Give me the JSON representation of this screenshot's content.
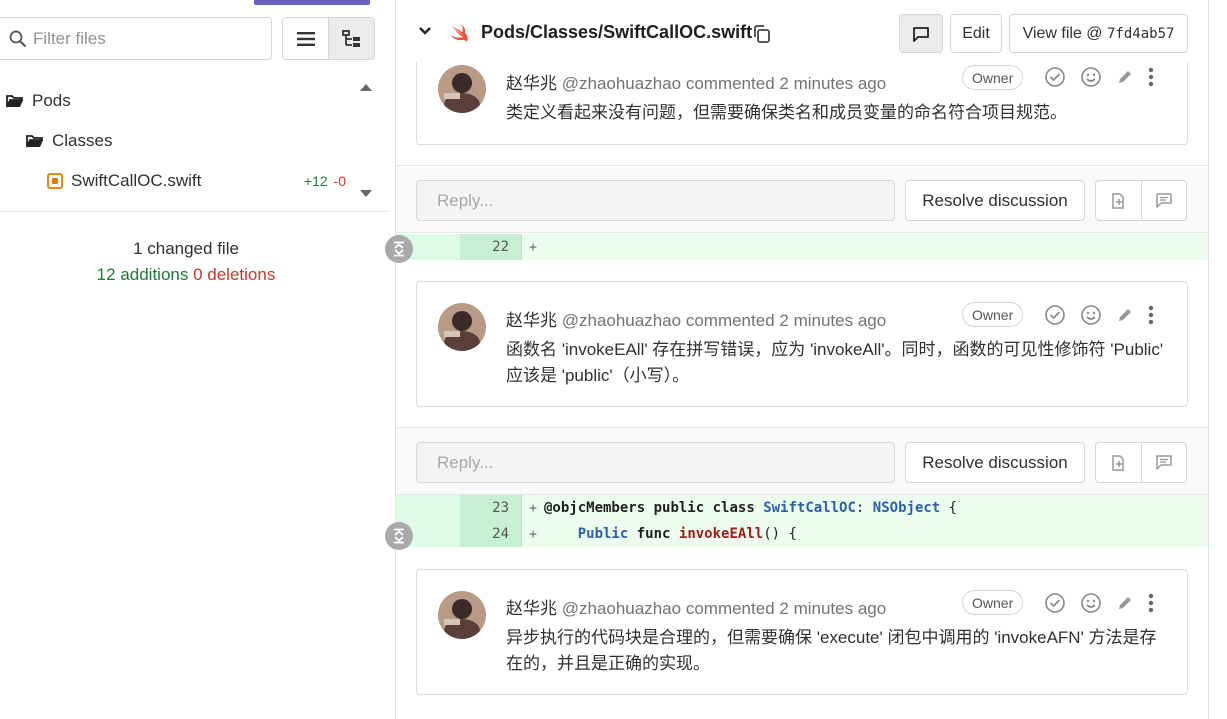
{
  "sidebar": {
    "filter_placeholder": "Filter files",
    "tree": [
      {
        "label": "Pods"
      },
      {
        "label": "Classes"
      },
      {
        "label": "SwiftCallOC.swift",
        "additions": "+12",
        "deletions": "-0"
      }
    ],
    "summary": {
      "changed": "1 changed file",
      "additions": "12 additions",
      "deletions": "0 deletions"
    }
  },
  "file": {
    "path": "Pods/Classes/SwiftCallOC.swift",
    "edit_label": "Edit",
    "view_label": "View file @",
    "commit": "7fd4ab57"
  },
  "discussions": [
    {
      "author": "赵华兆",
      "handle": "@zhaohuazhao",
      "commented": "commented",
      "time": "2 minutes ago",
      "badge": "Owner",
      "body": "类定义看起来没有问题，但需要确保类名和成员变量的命名符合项目规范。"
    },
    {
      "author": "赵华兆",
      "handle": "@zhaohuazhao",
      "commented": "commented",
      "time": "2 minutes ago",
      "badge": "Owner",
      "body": "函数名 'invokeEAll' 存在拼写错误，应为 'invokeAll'。同时，函数的可见性修饰符 'Public' 应该是 'public'（小写）。"
    },
    {
      "author": "赵华兆",
      "handle": "@zhaohuazhao",
      "commented": "commented",
      "time": "2 minutes ago",
      "badge": "Owner",
      "body": "异步执行的代码块是合理的，但需要确保 'execute' 闭包中调用的 'invokeAFN' 方法是存在的，并且是正确的实现。"
    }
  ],
  "reply": {
    "placeholder": "Reply...",
    "resolve_label": "Resolve discussion"
  },
  "diff": {
    "line22": {
      "num": "22",
      "sign": "+"
    },
    "line23": {
      "num": "23",
      "sign": "+",
      "attr": "@objcMembers",
      "kw1": "public",
      "kw2": "class",
      "cls": "SwiftCallOC",
      "colon": ":",
      "parent": "NSObject",
      "brace": "{"
    },
    "line24": {
      "num": "24",
      "sign": "+",
      "kw1": "Public",
      "kw2": "func",
      "fname": "invokeEAll",
      "rest": "() {"
    }
  },
  "colors": {
    "accent": "#6a5fc0",
    "addition": "#1f7a3a",
    "deletion": "#c0392b",
    "diff_added_bg": "#ecfdf0",
    "swift_orange": "#f05138"
  }
}
